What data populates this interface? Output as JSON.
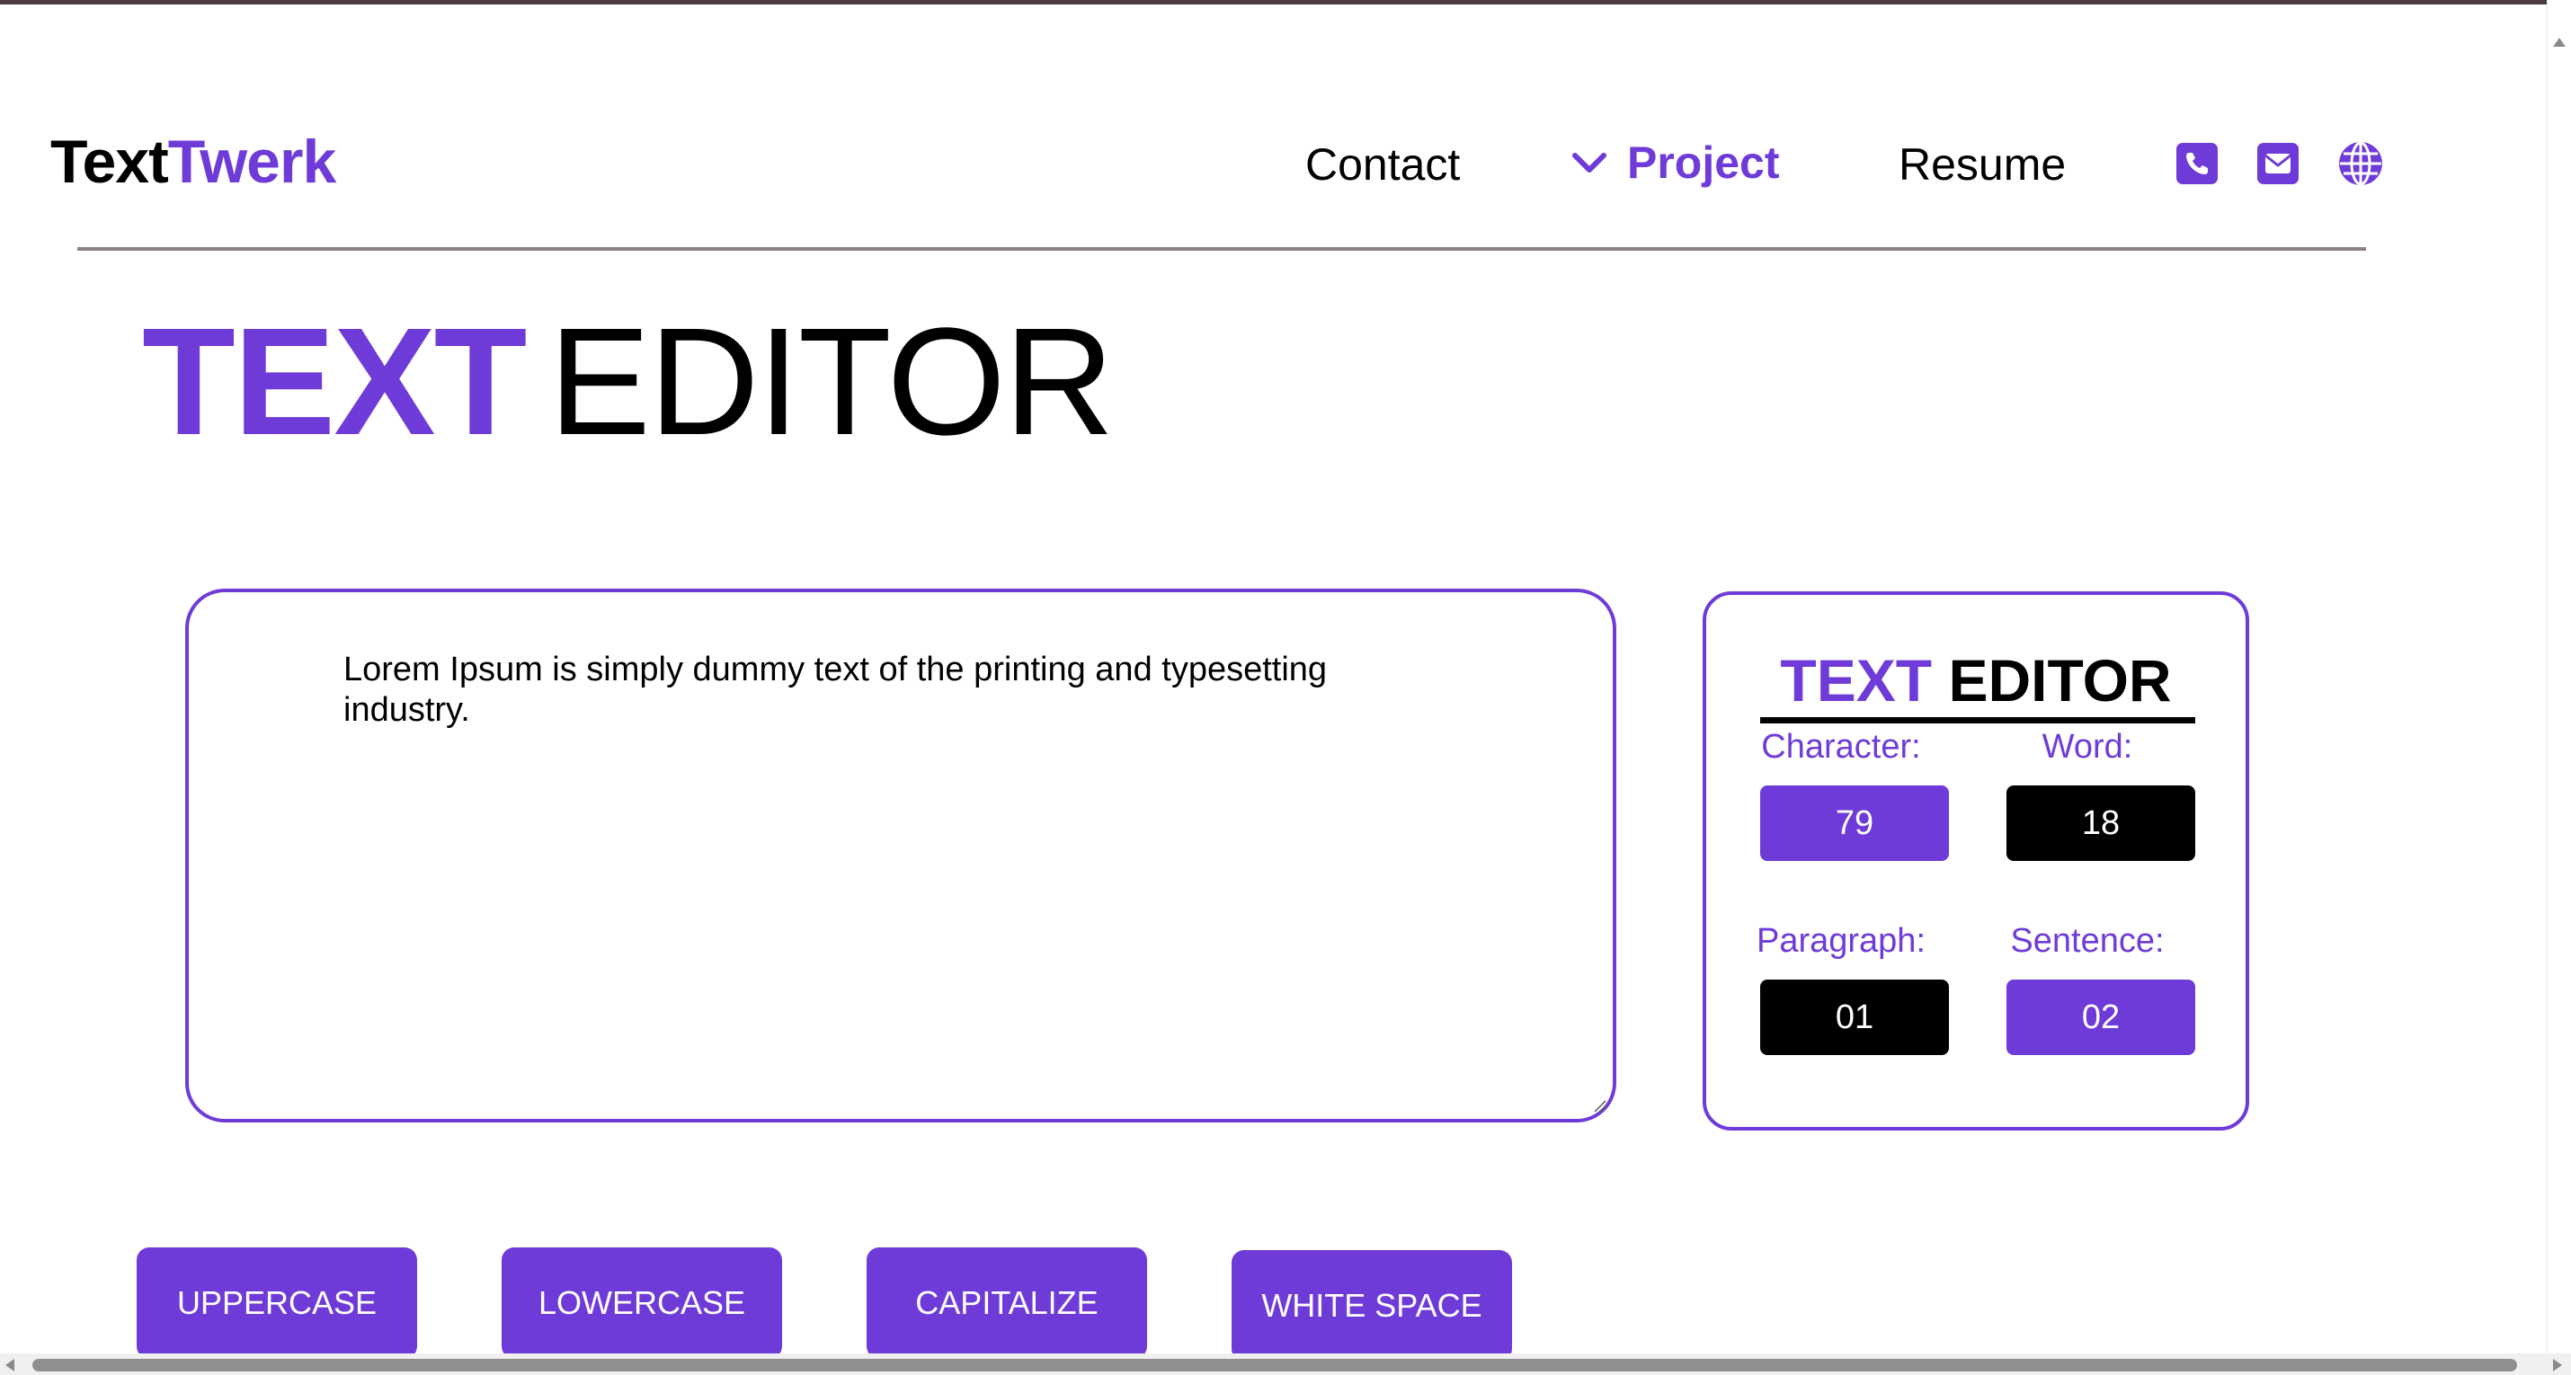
{
  "brand": {
    "part1": "Text",
    "part2": "Twerk"
  },
  "nav": {
    "contact": "Contact",
    "project": "Project",
    "resume": "Resume",
    "icons": [
      "phone-icon",
      "mail-icon",
      "globe-icon"
    ]
  },
  "hero": {
    "strong": "TEXT",
    "light": "EDITOR"
  },
  "editor": {
    "text": "Lorem Ipsum is simply dummy text of the printing and typesetting industry."
  },
  "stats": {
    "title_strong": "TEXT",
    "title_light": "EDITOR",
    "character_label": "Character:",
    "character_value": "79",
    "word_label": "Word:",
    "word_value": "18",
    "paragraph_label": "Paragraph:",
    "paragraph_value": "01",
    "sentence_label": "Sentence:",
    "sentence_value": "02"
  },
  "actions": {
    "uppercase": "UPPERCASE",
    "lowercase": "LOWERCASE",
    "capitalize": "CAPITALIZE",
    "white_space": "WHITE SPACE"
  },
  "colors": {
    "accent": "#6f3bd8",
    "dark": "#000000",
    "rule": "#8c7f88"
  }
}
